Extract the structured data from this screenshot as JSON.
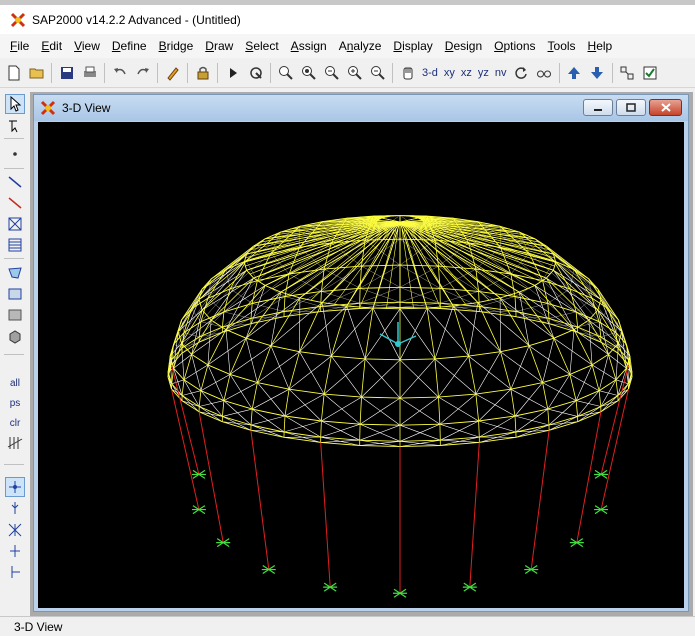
{
  "app": {
    "title": "SAP2000 v14.2.2 Advanced  - (Untitled)",
    "logo_icon": "sap-logo-icon"
  },
  "menu": [
    {
      "label": "File",
      "mnemonic": "F"
    },
    {
      "label": "Edit",
      "mnemonic": "E"
    },
    {
      "label": "View",
      "mnemonic": "V"
    },
    {
      "label": "Define",
      "mnemonic": "D"
    },
    {
      "label": "Bridge",
      "mnemonic": "B"
    },
    {
      "label": "Draw",
      "mnemonic": "D"
    },
    {
      "label": "Select",
      "mnemonic": "S"
    },
    {
      "label": "Assign",
      "mnemonic": "A"
    },
    {
      "label": "Analyze",
      "mnemonic": "n"
    },
    {
      "label": "Display",
      "mnemonic": "D"
    },
    {
      "label": "Design",
      "mnemonic": "D"
    },
    {
      "label": "Options",
      "mnemonic": "O"
    },
    {
      "label": "Tools",
      "mnemonic": "T"
    },
    {
      "label": "Help",
      "mnemonic": "H"
    }
  ],
  "toolbar": {
    "view_buttons": {
      "three_d": "3-d",
      "xy": "xy",
      "xz": "xz",
      "yz": "yz",
      "nv": "nv"
    }
  },
  "sidebar": {
    "select_all": "all",
    "select_previous": "ps",
    "clear_selection": "clr"
  },
  "child_window": {
    "title": "3-D View"
  },
  "statusbar": {
    "text": "3-D View"
  },
  "colors": {
    "dome_frame": "#ffff40",
    "interior_frame": "#ffffff",
    "columns": "#e02020",
    "supports": "#40e040",
    "axes": "#30c8d0",
    "background": "#000000"
  }
}
